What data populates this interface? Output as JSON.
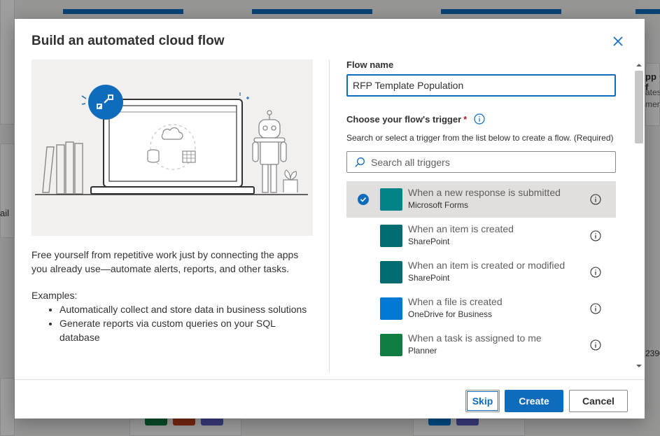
{
  "background": {
    "fragments": [
      "pp f",
      "ates",
      "mer",
      "ail",
      "2390"
    ]
  },
  "dialog": {
    "title": "Build an automated cloud flow",
    "close_icon": "close-icon",
    "description": "Free yourself from repetitive work just by connecting the apps you already use—automate alerts, reports, and other tasks.",
    "examples_label": "Examples:",
    "examples": [
      "Automatically collect and store data in business solutions",
      "Generate reports via custom queries on your SQL database"
    ],
    "flow_name_label": "Flow name",
    "flow_name_value": "RFP Template Population",
    "trigger_label": "Choose your flow's trigger",
    "required_marker": "*",
    "trigger_help": "Search or select a trigger from the list below to create a flow. (Required)",
    "search_placeholder": "Search all triggers",
    "triggers": [
      {
        "title": "When a new response is submitted",
        "connector": "Microsoft Forms",
        "color": "#038387",
        "selected": true
      },
      {
        "title": "When an item is created",
        "connector": "SharePoint",
        "color": "#036c70",
        "selected": false
      },
      {
        "title": "When an item is created or modified",
        "connector": "SharePoint",
        "color": "#036c70",
        "selected": false
      },
      {
        "title": "When a file is created",
        "connector": "OneDrive for Business",
        "color": "#0078d4",
        "selected": false
      },
      {
        "title": "When a task is assigned to me",
        "connector": "Planner",
        "color": "#107c41",
        "selected": false
      }
    ],
    "buttons": {
      "skip": "Skip",
      "create": "Create",
      "cancel": "Cancel"
    }
  },
  "colors": {
    "accent": "#0f6cbd",
    "required": "#a4262c",
    "selected_row": "#e1dfdd"
  }
}
